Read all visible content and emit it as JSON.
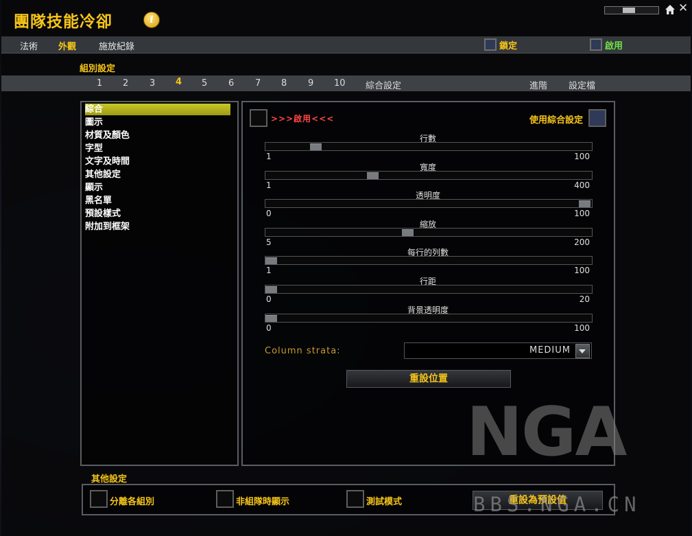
{
  "app": {
    "title": "團隊技能冷卻"
  },
  "tabs": [
    {
      "label": "法術",
      "active": false
    },
    {
      "label": "外觀",
      "active": true
    },
    {
      "label": "施放紀錄",
      "active": false
    }
  ],
  "top_checks": {
    "lock_label": "鎖定",
    "enable_label": "啟用"
  },
  "section": {
    "group_settings": "組別設定"
  },
  "group_tabs": [
    "1",
    "2",
    "3",
    "4",
    "5",
    "6",
    "7",
    "8",
    "9",
    "10",
    "綜合設定"
  ],
  "group_tab_active": "4",
  "right_tabs": {
    "advanced": "進階",
    "profiles": "設定檔"
  },
  "categories": [
    "綜合",
    "圖示",
    "材質及顏色",
    "字型",
    "文字及時間",
    "其他設定",
    "顯示",
    "黑名單",
    "預設樣式",
    "附加到框架"
  ],
  "selected_category": "綜合",
  "panel": {
    "enable_text": ">>>啟用<<<",
    "use_general": "使用綜合設定",
    "sliders": [
      {
        "label": "行數",
        "min": "1",
        "max": "100",
        "value": 15
      },
      {
        "label": "寬度",
        "min": "1",
        "max": "400",
        "value": 130
      },
      {
        "label": "透明度",
        "min": "0",
        "max": "100",
        "value": 100
      },
      {
        "label": "縮放",
        "min": "5",
        "max": "200",
        "value": 90
      },
      {
        "label": "每行的列數",
        "min": "1",
        "max": "100",
        "value": 1
      },
      {
        "label": "行距",
        "min": "0",
        "max": "20",
        "value": 0
      },
      {
        "label": "背景透明度",
        "min": "0",
        "max": "100",
        "value": 0
      }
    ],
    "strata_label": "Column strata:",
    "strata_value": "MEDIUM",
    "reset_position": "重設位置"
  },
  "bottom": {
    "label": "其他設定",
    "options": [
      "分離各組別",
      "非組隊時顯示",
      "測試模式"
    ],
    "reset_defaults": "重設為預設值"
  },
  "watermark": {
    "logo": "NGA",
    "url": "BBS.NGA.CN"
  },
  "colors": {
    "accent": "#f6c518",
    "enable_green": "#6fe04a",
    "warning_red": "#ff4646"
  }
}
